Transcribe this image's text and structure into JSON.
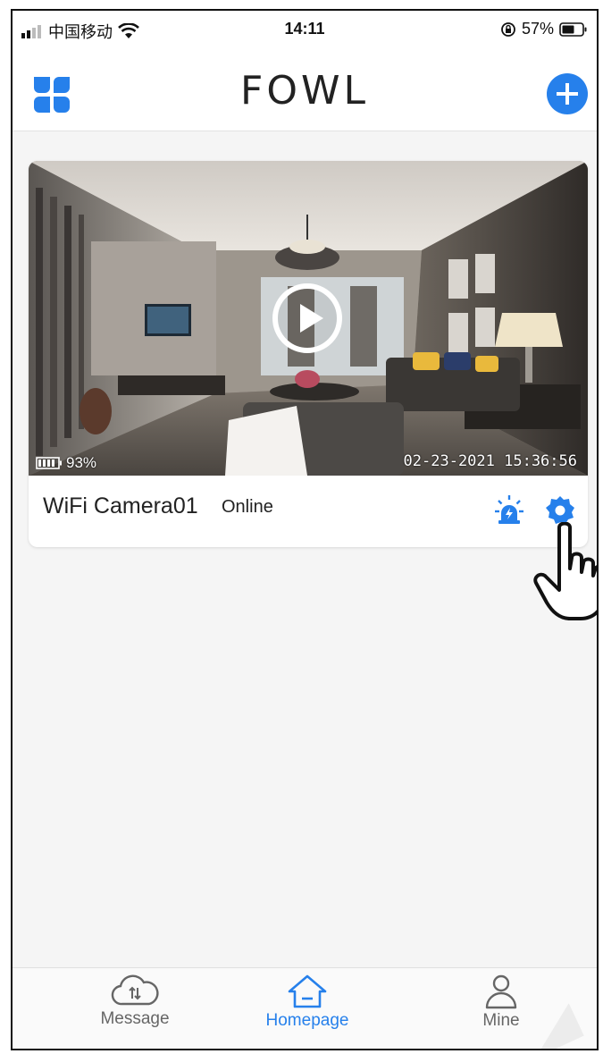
{
  "status_bar": {
    "carrier": "中国移动",
    "time": "14:11",
    "battery": "57%"
  },
  "header": {
    "logo": "FOWL"
  },
  "camera": {
    "name": "WiFi Camera01",
    "status": "Online",
    "battery_level": "93%",
    "timestamp": "02-23-2021 15:36:56"
  },
  "tabs": [
    {
      "label": "Message",
      "icon": "cloud-icon",
      "active": false
    },
    {
      "label": "Homepage",
      "icon": "home-icon",
      "active": true
    },
    {
      "label": "Mine",
      "icon": "person-icon",
      "active": false
    }
  ],
  "colors": {
    "accent": "#2680eb",
    "text": "#222222"
  }
}
